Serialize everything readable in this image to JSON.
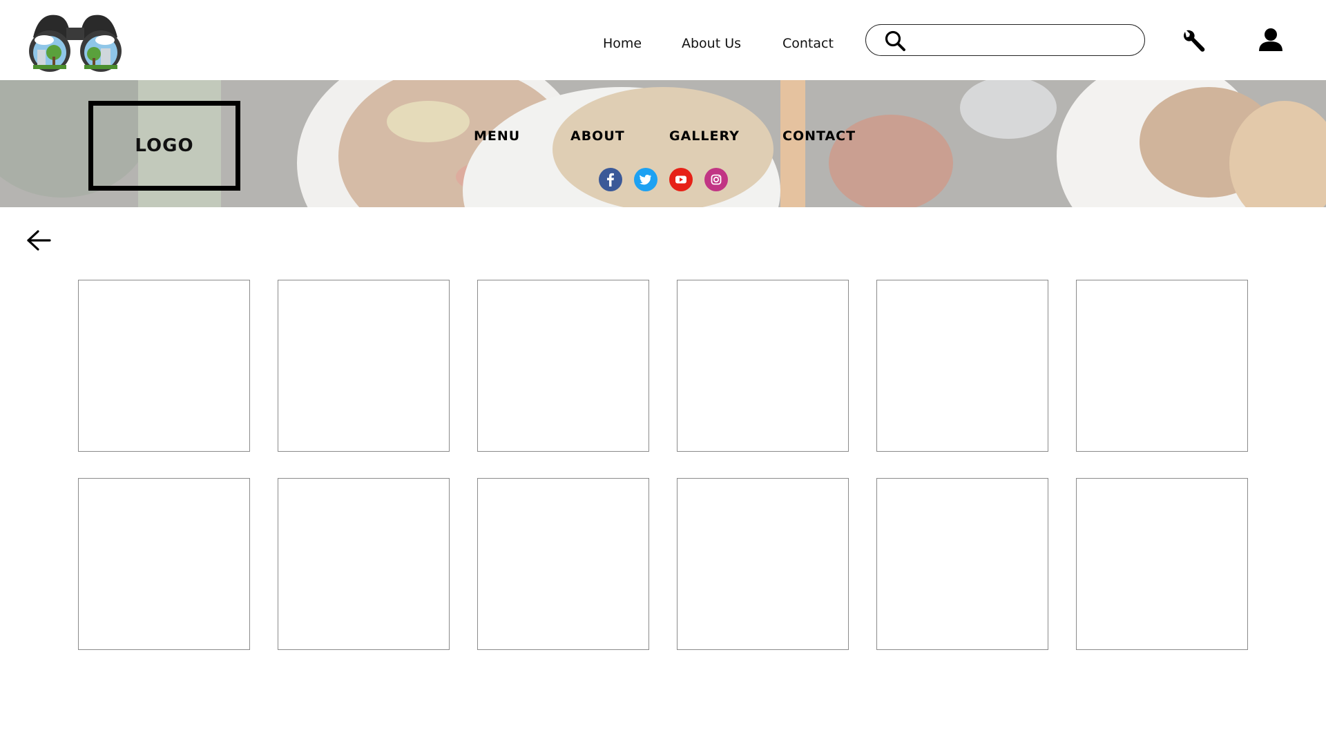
{
  "top_nav": {
    "links": [
      "Home",
      "About Us",
      "Contact"
    ]
  },
  "search": {
    "value": "",
    "placeholder": ""
  },
  "hero": {
    "logo_text": "LOGO",
    "nav": [
      "MENU",
      "ABOUT",
      "GALLERY",
      "CONTACT"
    ],
    "social": [
      {
        "name": "facebook",
        "color": "#3b5998"
      },
      {
        "name": "twitter",
        "color": "#1da1f2"
      },
      {
        "name": "youtube",
        "color": "#e62117"
      },
      {
        "name": "instagram",
        "color": "#c13584"
      }
    ]
  },
  "gallery": {
    "rows": 2,
    "columns": 6
  }
}
